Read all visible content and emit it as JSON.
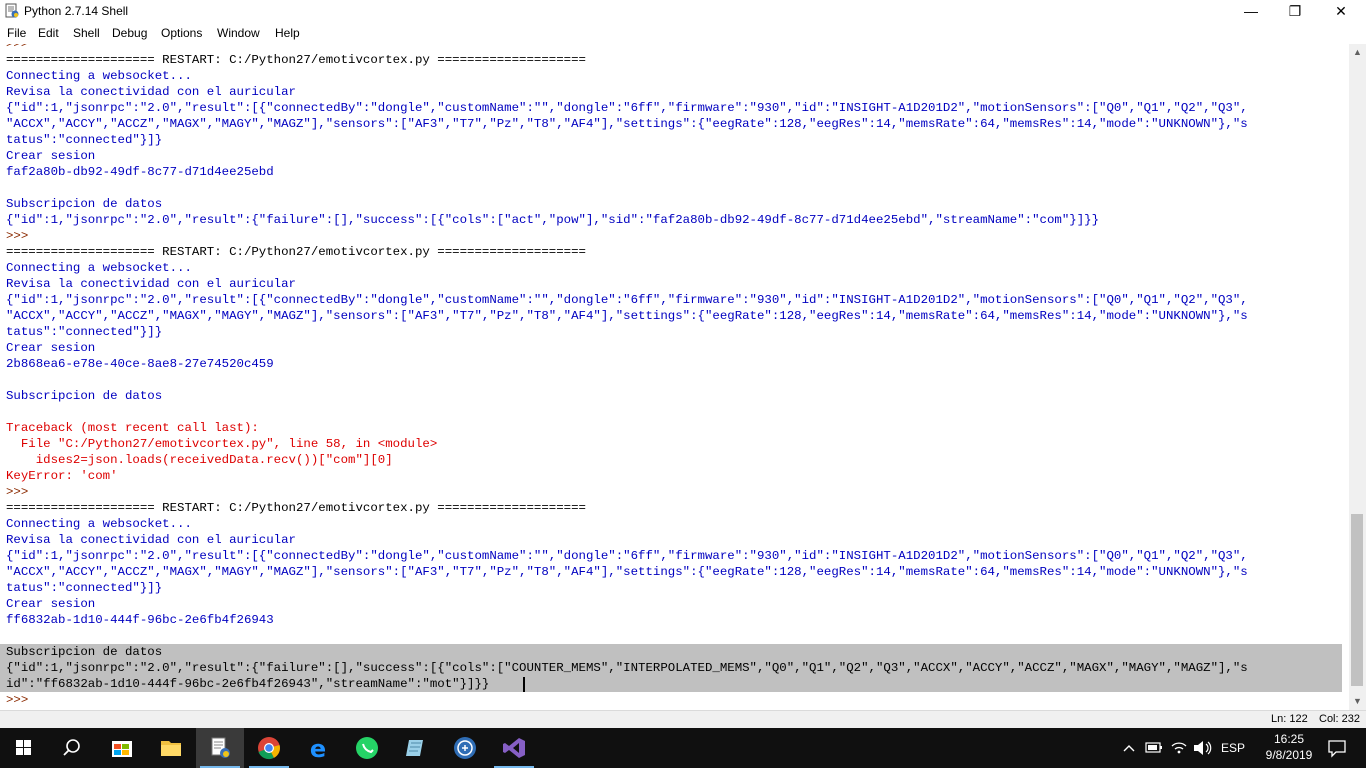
{
  "window": {
    "title": "Python 2.7.14 Shell",
    "minimize_glyph": "—",
    "maximize_glyph": "❐",
    "close_glyph": "✕"
  },
  "menu": [
    "File",
    "Edit",
    "Shell",
    "Debug",
    "Options",
    "Window",
    "Help"
  ],
  "shell_lines": [
    {
      "text": ">>>",
      "kind": "prompt"
    },
    {
      "text": "==================== RESTART: C:/Python27/emotivcortex.py ====================",
      "kind": "restart"
    },
    {
      "text": "Connecting a websocket...",
      "kind": "out"
    },
    {
      "text": "Revisa la conectividad con el auricular",
      "kind": "out"
    },
    {
      "text": "{\"id\":1,\"jsonrpc\":\"2.0\",\"result\":[{\"connectedBy\":\"dongle\",\"customName\":\"\",\"dongle\":\"6ff\",\"firmware\":\"930\",\"id\":\"INSIGHT-A1D201D2\",\"motionSensors\":[\"Q0\",\"Q1\",\"Q2\",\"Q3\",",
      "kind": "out"
    },
    {
      "text": "\"ACCX\",\"ACCY\",\"ACCZ\",\"MAGX\",\"MAGY\",\"MAGZ\"],\"sensors\":[\"AF3\",\"T7\",\"Pz\",\"T8\",\"AF4\"],\"settings\":{\"eegRate\":128,\"eegRes\":14,\"memsRate\":64,\"memsRes\":14,\"mode\":\"UNKNOWN\"},\"s",
      "kind": "out"
    },
    {
      "text": "tatus\":\"connected\"}]}",
      "kind": "out"
    },
    {
      "text": "Crear sesion",
      "kind": "out"
    },
    {
      "text": "faf2a80b-db92-49df-8c77-d71d4ee25ebd",
      "kind": "out"
    },
    {
      "text": "",
      "kind": "out"
    },
    {
      "text": "Subscripcion de datos",
      "kind": "out"
    },
    {
      "text": "{\"id\":1,\"jsonrpc\":\"2.0\",\"result\":{\"failure\":[],\"success\":[{\"cols\":[\"act\",\"pow\"],\"sid\":\"faf2a80b-db92-49df-8c77-d71d4ee25ebd\",\"streamName\":\"com\"}]}}",
      "kind": "out"
    },
    {
      "text": ">>>",
      "kind": "prompt"
    },
    {
      "text": "==================== RESTART: C:/Python27/emotivcortex.py ====================",
      "kind": "restart"
    },
    {
      "text": "Connecting a websocket...",
      "kind": "out"
    },
    {
      "text": "Revisa la conectividad con el auricular",
      "kind": "out"
    },
    {
      "text": "{\"id\":1,\"jsonrpc\":\"2.0\",\"result\":[{\"connectedBy\":\"dongle\",\"customName\":\"\",\"dongle\":\"6ff\",\"firmware\":\"930\",\"id\":\"INSIGHT-A1D201D2\",\"motionSensors\":[\"Q0\",\"Q1\",\"Q2\",\"Q3\",",
      "kind": "out"
    },
    {
      "text": "\"ACCX\",\"ACCY\",\"ACCZ\",\"MAGX\",\"MAGY\",\"MAGZ\"],\"sensors\":[\"AF3\",\"T7\",\"Pz\",\"T8\",\"AF4\"],\"settings\":{\"eegRate\":128,\"eegRes\":14,\"memsRate\":64,\"memsRes\":14,\"mode\":\"UNKNOWN\"},\"s",
      "kind": "out"
    },
    {
      "text": "tatus\":\"connected\"}]}",
      "kind": "out"
    },
    {
      "text": "Crear sesion",
      "kind": "out"
    },
    {
      "text": "2b868ea6-e78e-40ce-8ae8-27e74520c459",
      "kind": "out"
    },
    {
      "text": "",
      "kind": "out"
    },
    {
      "text": "Subscripcion de datos",
      "kind": "out"
    },
    {
      "text": "",
      "kind": "out"
    },
    {
      "text": "Traceback (most recent call last):",
      "kind": "err"
    },
    {
      "text": "  File \"C:/Python27/emotivcortex.py\", line 58, in <module>",
      "kind": "err"
    },
    {
      "text": "    idses2=json.loads(receivedData.recv())[\"com\"][0]",
      "kind": "err"
    },
    {
      "text": "KeyError: 'com'",
      "kind": "err"
    },
    {
      "text": ">>>",
      "kind": "prompt"
    },
    {
      "text": "==================== RESTART: C:/Python27/emotivcortex.py ====================",
      "kind": "restart"
    },
    {
      "text": "Connecting a websocket...",
      "kind": "out"
    },
    {
      "text": "Revisa la conectividad con el auricular",
      "kind": "out"
    },
    {
      "text": "{\"id\":1,\"jsonrpc\":\"2.0\",\"result\":[{\"connectedBy\":\"dongle\",\"customName\":\"\",\"dongle\":\"6ff\",\"firmware\":\"930\",\"id\":\"INSIGHT-A1D201D2\",\"motionSensors\":[\"Q0\",\"Q1\",\"Q2\",\"Q3\",",
      "kind": "out"
    },
    {
      "text": "\"ACCX\",\"ACCY\",\"ACCZ\",\"MAGX\",\"MAGY\",\"MAGZ\"],\"sensors\":[\"AF3\",\"T7\",\"Pz\",\"T8\",\"AF4\"],\"settings\":{\"eegRate\":128,\"eegRes\":14,\"memsRate\":64,\"memsRes\":14,\"mode\":\"UNKNOWN\"},\"s",
      "kind": "out"
    },
    {
      "text": "tatus\":\"connected\"}]}",
      "kind": "out"
    },
    {
      "text": "Crear sesion",
      "kind": "out"
    },
    {
      "text": "ff6832ab-1d10-444f-96bc-2e6fb4f26943",
      "kind": "out"
    },
    {
      "text": "",
      "kind": "out"
    },
    {
      "text": "Subscripcion de datos",
      "kind": "selected"
    },
    {
      "text": "{\"id\":1,\"jsonrpc\":\"2.0\",\"result\":{\"failure\":[],\"success\":[{\"cols\":[\"COUNTER_MEMS\",\"INTERPOLATED_MEMS\",\"Q0\",\"Q1\",\"Q2\",\"Q3\",\"ACCX\",\"ACCY\",\"ACCZ\",\"MAGX\",\"MAGY\",\"MAGZ\"],\"s",
      "kind": "selected"
    },
    {
      "text": "id\":\"ff6832ab-1d10-444f-96bc-2e6fb4f26943\",\"streamName\":\"mot\"}]}}",
      "kind": "selected"
    },
    {
      "text": ">>>",
      "kind": "prompt"
    }
  ],
  "status": {
    "ln": "Ln: 122",
    "col": "Col: 232"
  },
  "taskbar": {
    "language": "ESP",
    "time": "16:25",
    "date": "9/8/2019"
  }
}
